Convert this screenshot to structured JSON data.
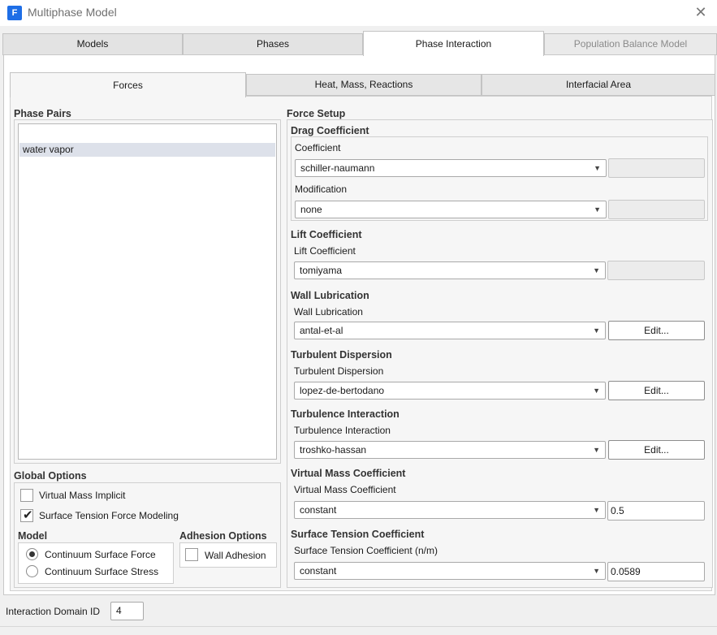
{
  "window": {
    "title": "Multiphase Model",
    "icon_letter": "F"
  },
  "main_tabs": [
    {
      "label": "Models"
    },
    {
      "label": "Phases"
    },
    {
      "label": "Phase Interaction"
    },
    {
      "label": "Population Balance Model"
    }
  ],
  "sub_tabs": [
    {
      "label": "Forces"
    },
    {
      "label": "Heat, Mass, Reactions"
    },
    {
      "label": "Interfacial Area"
    }
  ],
  "phase_pairs": {
    "title": "Phase Pairs",
    "items": [
      "water vapor"
    ]
  },
  "global_options": {
    "title": "Global Options",
    "virtual_mass_implicit": {
      "label": "Virtual Mass Implicit",
      "checked": false
    },
    "surface_tension_modeling": {
      "label": "Surface Tension Force Modeling",
      "checked": true
    }
  },
  "model": {
    "title": "Model",
    "options": [
      {
        "label": "Continuum Surface Force",
        "selected": true
      },
      {
        "label": "Continuum Surface Stress",
        "selected": false
      }
    ]
  },
  "adhesion": {
    "title": "Adhesion Options",
    "wall_adhesion": {
      "label": "Wall Adhesion",
      "checked": false
    }
  },
  "force_setup": {
    "title": "Force Setup",
    "drag": {
      "title": "Drag Coefficient",
      "coefficient_label": "Coefficient",
      "coefficient_value": "schiller-naumann",
      "modification_label": "Modification",
      "modification_value": "none"
    },
    "lift": {
      "title": "Lift Coefficient",
      "label": "Lift Coefficient",
      "value": "tomiyama"
    },
    "wall_lubrication": {
      "title": "Wall Lubrication",
      "label": "Wall Lubrication",
      "value": "antal-et-al",
      "button": "Edit..."
    },
    "turbulent_dispersion": {
      "title": "Turbulent Dispersion",
      "label": "Turbulent Dispersion",
      "value": "lopez-de-bertodano",
      "button": "Edit..."
    },
    "turbulence_interaction": {
      "title": "Turbulence Interaction",
      "label": "Turbulence Interaction",
      "value": "troshko-hassan",
      "button": "Edit..."
    },
    "virtual_mass": {
      "title": "Virtual Mass Coefficient",
      "label": "Virtual Mass Coefficient",
      "value": "constant",
      "number": "0.5"
    },
    "surface_tension": {
      "title": "Surface Tension Coefficient",
      "label": "Surface Tension Coefficient (n/m)",
      "value": "constant",
      "number": "0.0589"
    }
  },
  "footer": {
    "domain_label": "Interaction Domain ID",
    "domain_value": "4"
  }
}
